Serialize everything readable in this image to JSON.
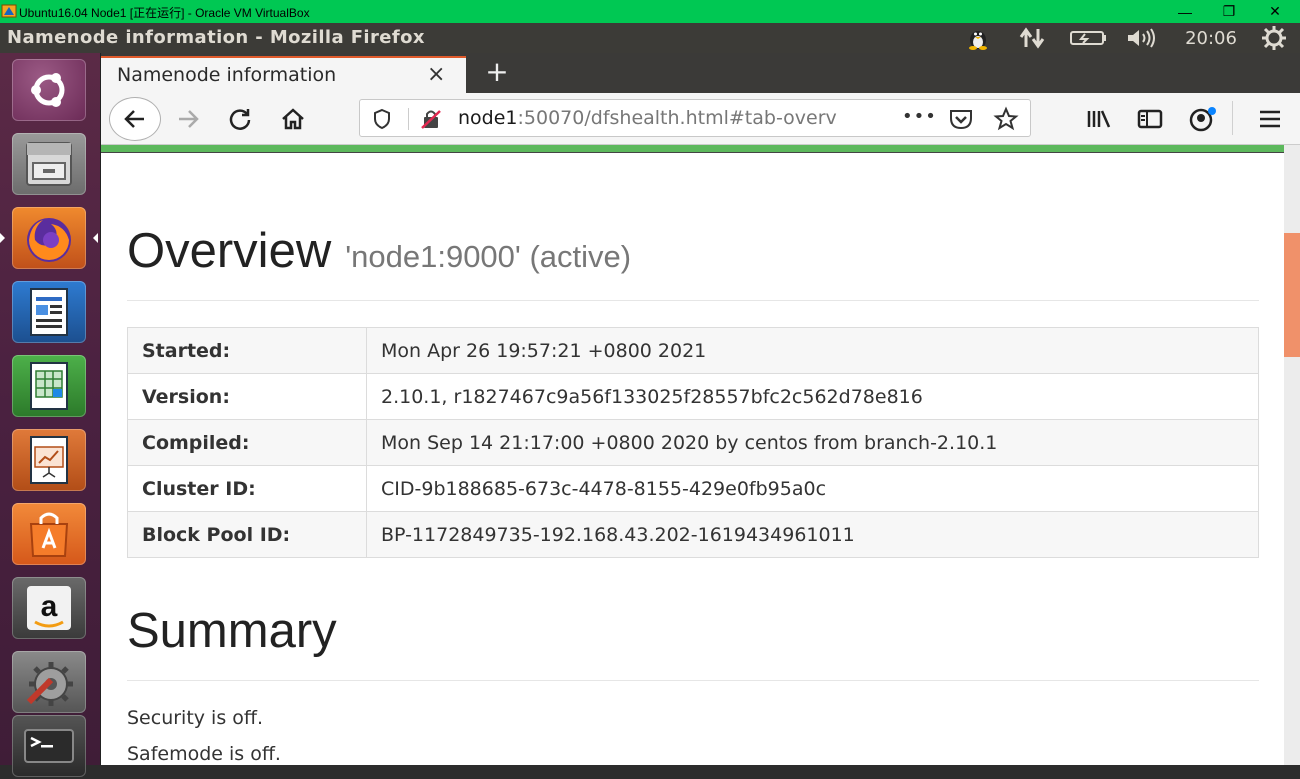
{
  "vbox": {
    "title": "Ubuntu16.04 Node1 [正在运行] - Oracle VM VirtualBox",
    "minimize": "—",
    "restore": "❐",
    "close": "✕"
  },
  "ubuntu_panel": {
    "window_title": "Namenode information - Mozilla Firefox",
    "clock": "20:06",
    "indicators": [
      "tux-icon",
      "network-updown-icon",
      "battery-icon",
      "volume-icon",
      "gear-power-icon"
    ]
  },
  "launcher": {
    "items": [
      "ubuntu-dash",
      "files",
      "firefox",
      "libreoffice-writer",
      "libreoffice-calc",
      "libreoffice-impress",
      "ubuntu-software",
      "amazon",
      "system-settings",
      "terminal"
    ],
    "active": "firefox"
  },
  "firefox": {
    "tab_label": "Namenode information",
    "tab_close": "×",
    "new_tab": "+",
    "url_host": "node1",
    "url_rest": ":50070/dfshealth.html#tab-overv",
    "page_actions": "•••"
  },
  "page": {
    "overview_title": "Overview",
    "overview_subtitle": "'node1:9000' (active)",
    "info_rows": [
      {
        "key": "Started:",
        "value": "Mon Apr 26 19:57:21 +0800 2021"
      },
      {
        "key": "Version:",
        "value": "2.10.1, r1827467c9a56f133025f28557bfc2c562d78e816"
      },
      {
        "key": "Compiled:",
        "value": "Mon Sep 14 21:17:00 +0800 2020 by centos from branch-2.10.1"
      },
      {
        "key": "Cluster ID:",
        "value": "CID-9b188685-673c-4478-8155-429e0fb95a0c"
      },
      {
        "key": "Block Pool ID:",
        "value": "BP-1172849735-192.168.43.202-1619434961011"
      }
    ],
    "summary_title": "Summary",
    "security_text": "Security is off.",
    "safemode_text": "Safemode is off."
  },
  "colors": {
    "vbox_green": "#00c853",
    "panel_dark": "#3c3b37",
    "launcher_purple": "#4a2140",
    "tab_accent": "#e05a2b",
    "page_green": "#5cb85c",
    "scroll_thumb": "#f0916a"
  }
}
